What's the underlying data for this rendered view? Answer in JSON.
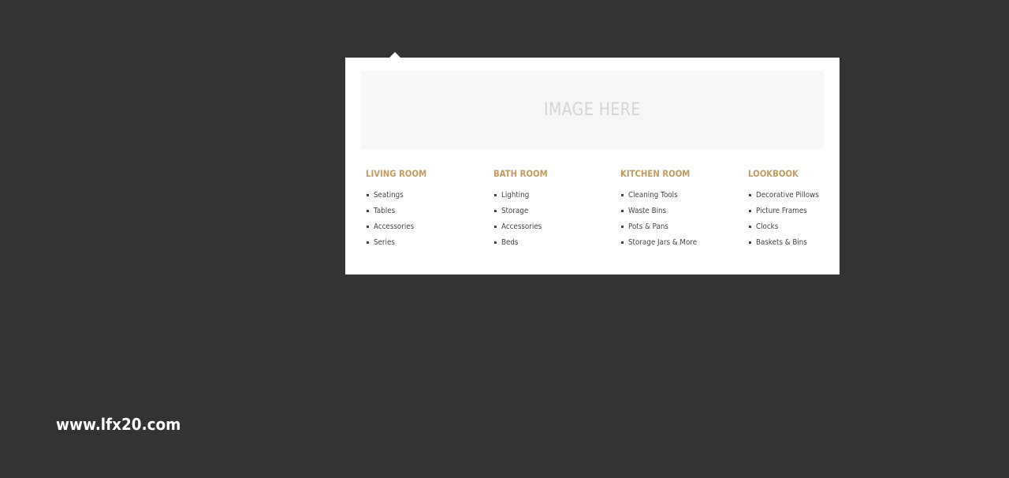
{
  "menu": {
    "image_placeholder": "IMAGE HERE",
    "columns": [
      {
        "heading": "LIVING ROOM",
        "items": [
          "Seatings",
          "Tables",
          "Accessories",
          "Series"
        ]
      },
      {
        "heading": "BATH ROOM",
        "items": [
          "Lighting",
          "Storage",
          "Accessories",
          "Beds"
        ]
      },
      {
        "heading": "KITCHEN ROOM",
        "items": [
          "Cleaning Tools",
          "Waste Bins",
          "Pots & Pans",
          "Storage Jars & More"
        ]
      },
      {
        "heading": "LOOKBOOK",
        "items": [
          "Decorative Pillows",
          "Picture Frames",
          "Clocks",
          "Baskets & Bins"
        ]
      }
    ]
  },
  "watermark": "www.lfx20.com",
  "colors": {
    "background": "#333333",
    "panel": "#ffffff",
    "placeholder": "#f7f7f7",
    "heading_accent": "#c49a5c",
    "item_text": "#444444"
  }
}
